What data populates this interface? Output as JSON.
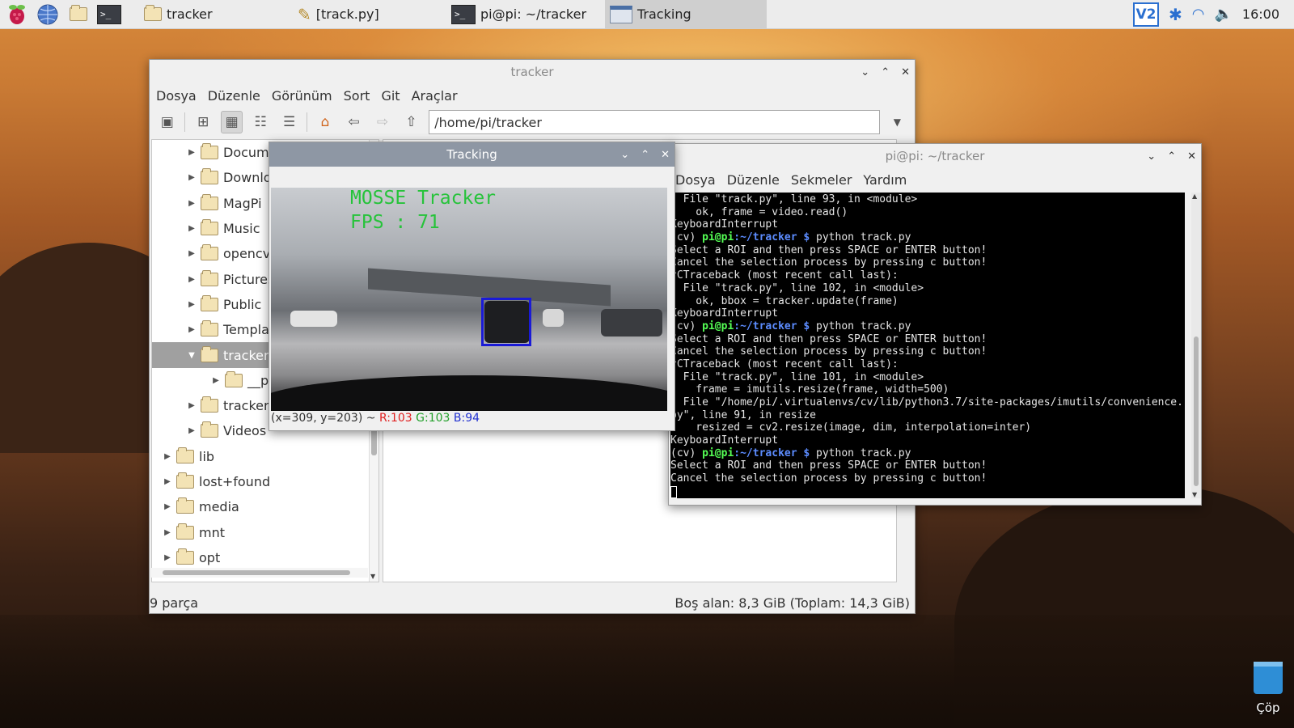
{
  "taskbar": {
    "tasks": [
      {
        "label": "tracker",
        "icon": "folder-icon"
      },
      {
        "label": "[track.py]",
        "icon": "pencil-icon"
      },
      {
        "label": "pi@pi: ~/tracker",
        "icon": "terminal-icon"
      },
      {
        "label": "Tracking",
        "icon": "window-icon",
        "active": true
      }
    ],
    "clock": "16:00"
  },
  "file_manager": {
    "title": "tracker",
    "menu": [
      "Dosya",
      "Düzenle",
      "Görünüm",
      "Sort",
      "Git",
      "Araçlar"
    ],
    "path": "/home/pi/tracker",
    "tree": [
      {
        "label": "Documents",
        "indent": 2,
        "icon": "documents-folder-icon"
      },
      {
        "label": "Downloads",
        "indent": 2,
        "icon": "downloads-folder-icon"
      },
      {
        "label": "MagPi",
        "indent": 2,
        "icon": "folder-icon"
      },
      {
        "label": "Music",
        "indent": 2,
        "icon": "music-folder-icon"
      },
      {
        "label": "opencv",
        "indent": 2,
        "icon": "folder-icon"
      },
      {
        "label": "Pictures",
        "indent": 2,
        "icon": "pictures-folder-icon"
      },
      {
        "label": "Public",
        "indent": 2,
        "icon": "public-folder-icon"
      },
      {
        "label": "Templates",
        "indent": 2,
        "icon": "templates-folder-icon"
      },
      {
        "label": "tracker",
        "indent": 2,
        "icon": "folder-icon",
        "selected": true,
        "expanded": true
      },
      {
        "label": "__pycache__",
        "indent": 3,
        "icon": "folder-icon"
      },
      {
        "label": "trackerold",
        "indent": 2,
        "icon": "folder-icon"
      },
      {
        "label": "Videos",
        "indent": 2,
        "icon": "videos-folder-icon"
      },
      {
        "label": "lib",
        "indent": 1,
        "icon": "folder-icon"
      },
      {
        "label": "lost+found",
        "indent": 1,
        "icon": "folder-icon"
      },
      {
        "label": "media",
        "indent": 1,
        "icon": "folder-icon"
      },
      {
        "label": "mnt",
        "indent": 1,
        "icon": "folder-icon"
      },
      {
        "label": "opt",
        "indent": 1,
        "icon": "folder-icon"
      }
    ],
    "status_left": "9 parça",
    "status_right": "Boş alan: 8,3 GiB (Toplam: 14,3 GiB)"
  },
  "terminal": {
    "title": "pi@pi: ~/tracker",
    "menu": [
      "Dosya",
      "Düzenle",
      "Sekmeler",
      "Yardım"
    ],
    "lines": [
      {
        "text": "  File \"track.py\", line 93, in <module>"
      },
      {
        "text": "    ok, frame = video.read()"
      },
      {
        "text": "KeyboardInterrupt"
      },
      {
        "prompt": true,
        "cmd": "python track.py"
      },
      {
        "text": "Select a ROI and then press SPACE or ENTER button!"
      },
      {
        "text": "Cancel the selection process by pressing c button!"
      },
      {
        "text": "^CTraceback (most recent call last):"
      },
      {
        "text": "  File \"track.py\", line 102, in <module>"
      },
      {
        "text": "    ok, bbox = tracker.update(frame)"
      },
      {
        "text": "KeyboardInterrupt"
      },
      {
        "prompt": true,
        "cmd": "python track.py"
      },
      {
        "text": "Select a ROI and then press SPACE or ENTER button!"
      },
      {
        "text": "Cancel the selection process by pressing c button!"
      },
      {
        "text": "^CTraceback (most recent call last):"
      },
      {
        "text": "  File \"track.py\", line 101, in <module>"
      },
      {
        "text": "    frame = imutils.resize(frame, width=500)"
      },
      {
        "text": "  File \"/home/pi/.virtualenvs/cv/lib/python3.7/site-packages/imutils/convenience."
      },
      {
        "text": "py\", line 91, in resize"
      },
      {
        "text": "    resized = cv2.resize(image, dim, interpolation=inter)"
      },
      {
        "text": "KeyboardInterrupt"
      },
      {
        "prompt": true,
        "cmd": "python track.py"
      },
      {
        "text": "Select a ROI and then press SPACE or ENTER button!"
      },
      {
        "text": "Cancel the selection process by pressing c button!"
      }
    ],
    "prompt_env": "(cv) ",
    "prompt_user": "pi@pi",
    "prompt_path": ":~/tracker $ "
  },
  "tracking": {
    "title": "Tracking",
    "overlay_line1": "MOSSE Tracker",
    "overlay_line2": "FPS : 71",
    "pixel_info_prefix": "(x=309, y=203) ~ ",
    "pixel_r": "R:103",
    "pixel_g": "G:103",
    "pixel_b": "B:94"
  },
  "desktop": {
    "trash_label": "Çöp"
  },
  "colors": {
    "roi_box": "#1a1ad6",
    "overlay_text": "#26c33a",
    "prompt_green": "#55ff55",
    "prompt_blue": "#5c8cff"
  }
}
